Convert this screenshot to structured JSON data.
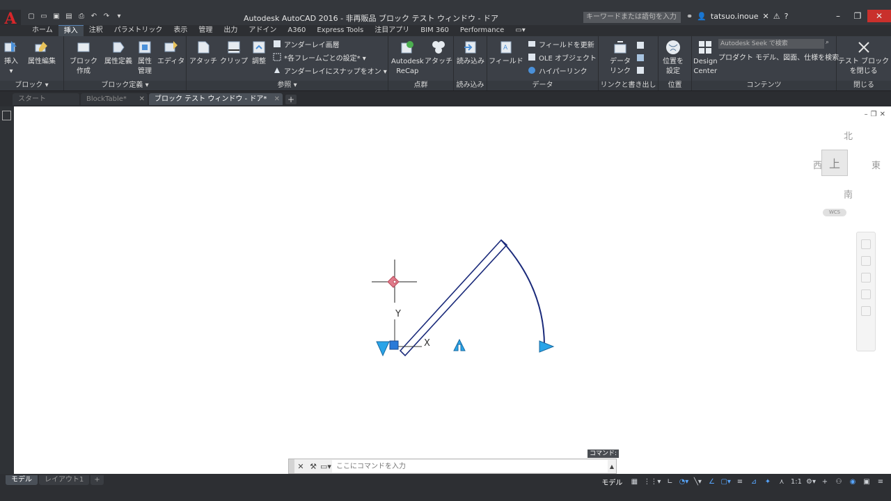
{
  "titlebar": {
    "logo": "A",
    "title": "Autodesk AutoCAD 2016 - 非再販品    ブロック テスト ウィンドウ - ドア",
    "search_placeholder": "キーワードまたは語句を入力",
    "username": "tatsuo.inoue",
    "help": "?",
    "qat_icons": [
      "new-icon",
      "open-icon",
      "save-icon",
      "saveas-icon",
      "print-icon",
      "undo-icon",
      "redo-icon"
    ]
  },
  "ribbon_tabs": [
    {
      "label": "ホーム",
      "active": false
    },
    {
      "label": "挿入",
      "active": true
    },
    {
      "label": "注釈",
      "active": false
    },
    {
      "label": "パラメトリック",
      "active": false
    },
    {
      "label": "表示",
      "active": false
    },
    {
      "label": "管理",
      "active": false
    },
    {
      "label": "出力",
      "active": false
    },
    {
      "label": "アドイン",
      "active": false
    },
    {
      "label": "A360",
      "active": false
    },
    {
      "label": "Express Tools",
      "active": false
    },
    {
      "label": "注目アプリ",
      "active": false
    },
    {
      "label": "BIM 360",
      "active": false
    },
    {
      "label": "Performance",
      "active": false
    }
  ],
  "ribbon": {
    "block": {
      "title": "ブロック ▾",
      "insert": "挿入",
      "edit_attr": "属性編集"
    },
    "block_def": {
      "title": "ブロック定義 ▾",
      "create": "ブロック\n作成",
      "define_attr": "属性定義",
      "manage_attr": "属性\n管理",
      "editor": "エディタ"
    },
    "reference": {
      "title": "参照 ▾",
      "attach": "アタッチ",
      "clip": "クリップ",
      "adjust": "調整",
      "underlay_layers": "アンダーレイ画層",
      "frames": "*各フレームごとの設定* ▾",
      "snap": "アンダーレイにスナップをオン ▾"
    },
    "pointcloud": {
      "title": "点群",
      "recap": "Autodesk\nReCap",
      "attach": "アタッチ"
    },
    "import": {
      "title": "読み込み",
      "import": "読み込み"
    },
    "data": {
      "title": "データ",
      "field": "フィールド",
      "update_fields": "フィールドを更新",
      "ole": "OLE オブジェクト",
      "hyperlink": "ハイパーリンク"
    },
    "linking": {
      "title": "リンクと書き出し",
      "data_link": "データ\nリンク"
    },
    "location": {
      "title": "位置",
      "set_location": "位置を\n設定"
    },
    "content": {
      "title": "コンテンツ",
      "design_center": "Design\nCenter",
      "seek_placeholder": "Autodesk Seek で検索",
      "seek_desc": "プロダクト モデル、図面、仕様を検索"
    },
    "close": {
      "title": "閉じる",
      "close_test": "テスト ブロック\nを閉じる"
    }
  },
  "file_tabs": [
    {
      "label": "スタート",
      "active": false
    },
    {
      "label": "BlockTable*",
      "active": false
    },
    {
      "label": "ブロック テスト ウィンドウ - ドア*",
      "active": true
    }
  ],
  "viewcube": {
    "north": "北",
    "south": "南",
    "east": "東",
    "west": "西",
    "top": "上",
    "wcs": "WCS"
  },
  "ucs": {
    "y_label": "Y",
    "x_label": "X"
  },
  "commandline": {
    "label": "コマンド:",
    "placeholder": "ここにコマンドを入力"
  },
  "layout_tabs": [
    {
      "label": "モデル",
      "active": true
    },
    {
      "label": "レイアウト1",
      "active": false
    }
  ],
  "statusbar": {
    "model": "モデル",
    "scale": "1:1"
  },
  "colors": {
    "accent": "#57a6ff",
    "door_stroke": "#1a2a7a",
    "grip_blue": "#2aa4e8",
    "close_red": "#c9302c"
  }
}
